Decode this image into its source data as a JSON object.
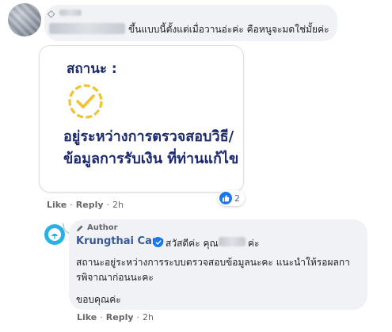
{
  "comment1": {
    "avatar_icon": "user-avatar-icon",
    "badge_icon": "diamond-icon",
    "text": "ขึ้นแบบนี้ตั้งแต่เมื่อวานอ่ะค่ะ คือหนูจะมดใช่มั้ยค่ะ",
    "attachment": {
      "status_label": "สถานะ :",
      "status_line1": "อยู่ระหว่างการตรวจสอบวิธี/",
      "status_line2": "ข้อมูลการรับเงิน ที่ท่านแก้ไข",
      "check_icon": "check-circle-icon",
      "accent_color": "#f2c230",
      "text_color": "#1d2a6e"
    },
    "reactions": {
      "icon": "like-icon",
      "count": "2"
    },
    "actions": {
      "like": "Like",
      "reply": "Reply",
      "time": "2h",
      "separator": "·"
    }
  },
  "reply1": {
    "author_badge": "Author",
    "author_badge_icon": "pencil-icon",
    "author_name": "Krungthai Care",
    "verified_icon": "verified-badge-icon",
    "greeting_start": "สวัสดีค่ะ คุณ",
    "greeting_end": "ค่ะ",
    "body": "สถานะอยู่ระหว่างการระบบตรวจสอบข้อมูลนะคะ แนะนำให้รอผลการพิจาณาก่อนนะคะ",
    "sign_off": "ขอบคุณค่ะ",
    "actions": {
      "like": "Like",
      "reply": "Reply",
      "time": "2h",
      "separator": "·"
    },
    "avatar_color": "#2ab0e6"
  },
  "colors": {
    "link": "#385898",
    "meta": "#65676b",
    "bubble": "#f0f2f5",
    "fb_blue": "#1877f2"
  }
}
